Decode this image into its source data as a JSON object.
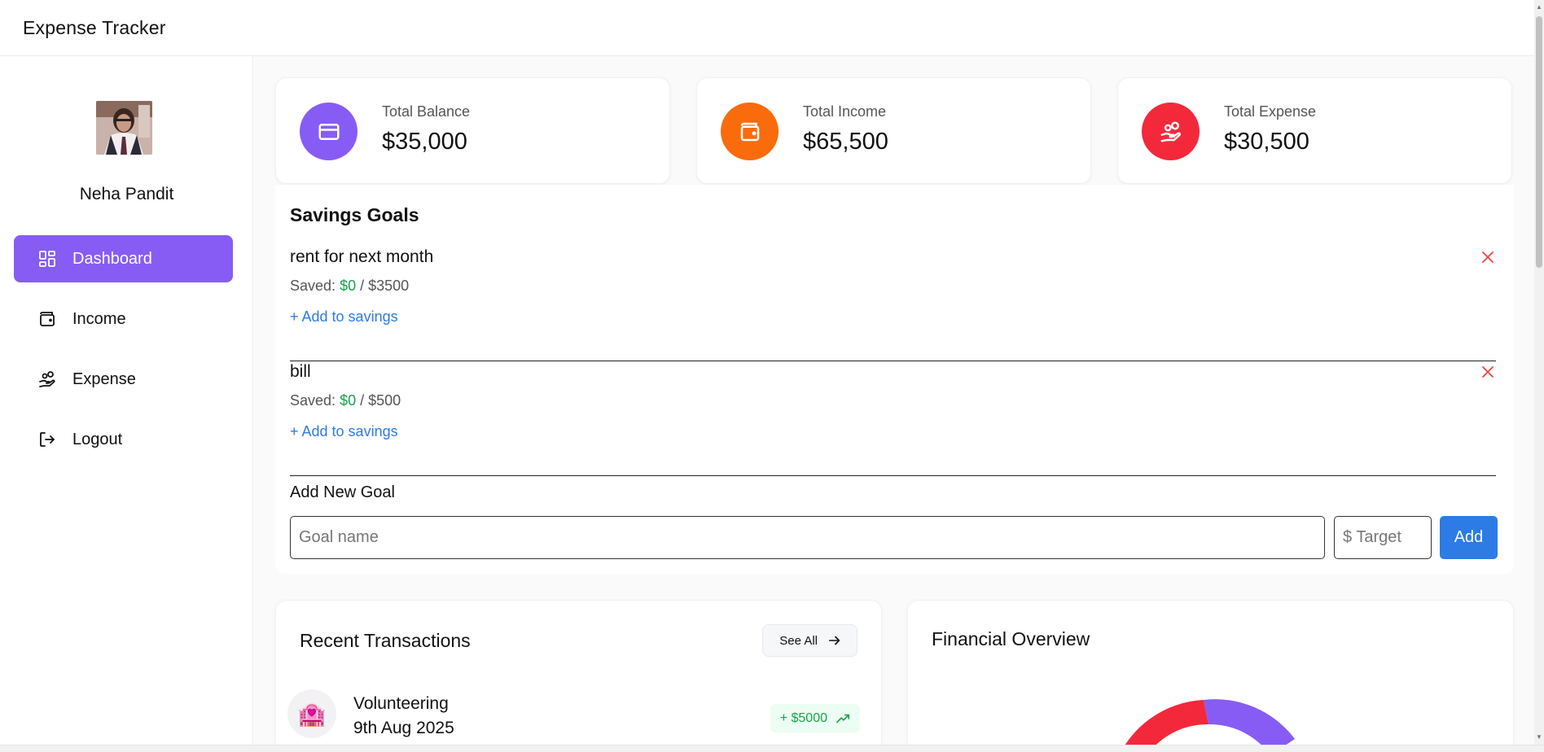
{
  "app": {
    "title": "Expense Tracker"
  },
  "user": {
    "name": "Neha Pandit"
  },
  "sidebar": {
    "items": [
      {
        "label": "Dashboard",
        "icon": "dashboard-grid-icon",
        "active": true
      },
      {
        "label": "Income",
        "icon": "wallet-icon",
        "active": false
      },
      {
        "label": "Expense",
        "icon": "hand-coins-icon",
        "active": false
      },
      {
        "label": "Logout",
        "icon": "logout-icon",
        "active": false
      }
    ]
  },
  "stats": [
    {
      "label": "Total Balance",
      "value": "$35,000",
      "icon": "credit-card-icon",
      "color": "#875cf5"
    },
    {
      "label": "Total Income",
      "value": "$65,500",
      "icon": "wallet-icon",
      "color": "#fa6b0c"
    },
    {
      "label": "Total Expense",
      "value": "$30,500",
      "icon": "hand-coins-icon",
      "color": "#f4283b"
    }
  ],
  "savings": {
    "title": "Savings Goals",
    "goals": [
      {
        "name": "rent for next month",
        "saved_prefix": "Saved:",
        "saved": "$0",
        "separator": "/",
        "target": "$3500",
        "add_label": "+ Add to savings"
      },
      {
        "name": "bill",
        "saved_prefix": "Saved:",
        "saved": "$0",
        "separator": "/",
        "target": "$500",
        "add_label": "+ Add to savings"
      }
    ],
    "new_goal": {
      "title": "Add New Goal",
      "name_placeholder": "Goal name",
      "target_placeholder": "$ Target",
      "add_label": "Add"
    }
  },
  "transactions": {
    "title": "Recent Transactions",
    "see_all_label": "See All",
    "items": [
      {
        "emoji": "🏩",
        "name": "Volunteering",
        "date": "9th Aug 2025",
        "amount": "+ $5000"
      }
    ]
  },
  "financial_overview": {
    "title": "Financial Overview",
    "colors": {
      "balance": "#875cf5",
      "expense": "#f4283b",
      "income": "#fa6b0c"
    }
  }
}
